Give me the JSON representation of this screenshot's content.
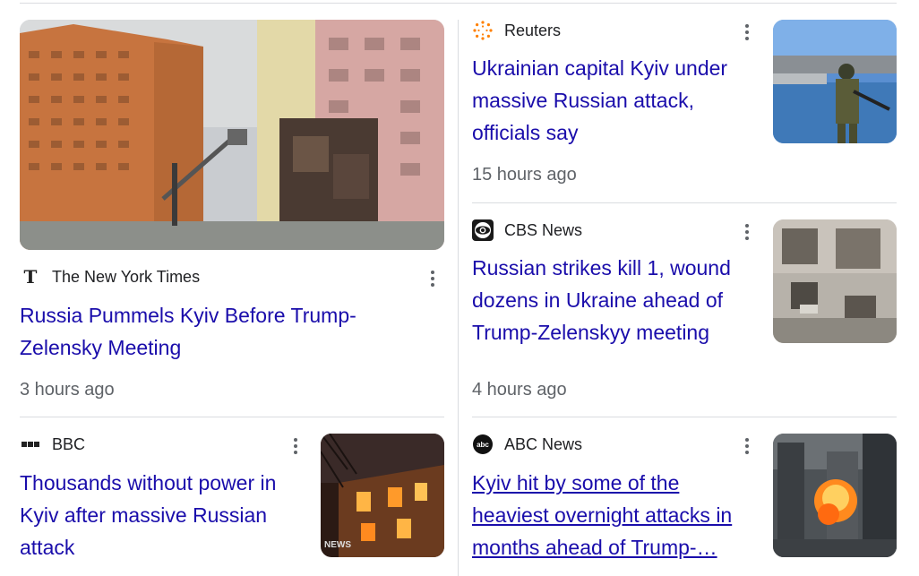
{
  "articles": [
    {
      "source": "The New York Times",
      "headline": "Russia Pummels Kyiv Before Trump-Zelensky Meeting",
      "time": "3 hours ago"
    },
    {
      "source": "Reuters",
      "headline": "Ukrainian capital Kyiv under massive Russian attack, officials say",
      "time": "15 hours ago"
    },
    {
      "source": "CBS News",
      "headline": "Russian strikes kill 1, wound dozens in Ukraine ahead of Trump-Zelenskyy meeting",
      "time": "4 hours ago"
    },
    {
      "source": "BBC",
      "headline": "Thousands without power in Kyiv after massive Russian attack",
      "thumb_caption": "NEWS"
    },
    {
      "source": "ABC News",
      "headline": "Kyiv hit by some of the heaviest overnight attacks in months ahead of Trump-…"
    }
  ],
  "icons": {
    "more": "more-vert-icon",
    "nyt": "nyt-logo-icon",
    "reuters": "reuters-logo-icon",
    "cbs": "cbs-eye-logo-icon",
    "bbc": "bbc-logo-icon",
    "abc": "abc-logo-icon"
  },
  "colors": {
    "headline": "#1a0dab",
    "meta": "#5f6368",
    "divider": "#dadce0",
    "reuters_orange": "#ff8000"
  }
}
